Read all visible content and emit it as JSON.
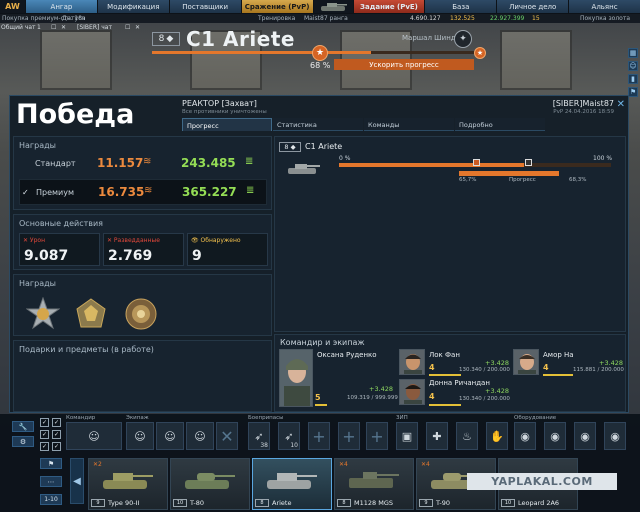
{
  "nav": {
    "logo": "AW",
    "tabs": [
      {
        "label": "Ангар",
        "style": "active"
      },
      {
        "label": "Модификация",
        "style": ""
      },
      {
        "label": "Поставщики",
        "style": ""
      },
      {
        "label": "Сражение (PvP)",
        "style": "pvp"
      },
      {
        "label": "",
        "style": "tankslot"
      },
      {
        "label": "Задание (PvE)",
        "style": "pve"
      },
      {
        "label": "База",
        "style": ""
      },
      {
        "label": "Личное дело",
        "style": ""
      },
      {
        "label": "Альянс",
        "style": ""
      }
    ]
  },
  "subnav": {
    "premium_link": "Покупка премиум-статуса",
    "premium_days": "Дн. 18ч",
    "mode": "Тренировка",
    "player_small": "Maist87 ранга",
    "silver": "4.690.127",
    "gold": "132.525",
    "xp": "22.927.399",
    "xp2": "15",
    "buy_gold": "Покупка золота"
  },
  "chats": {
    "general": "Общий чат",
    "general_count": "1",
    "clan": "[SIBER] чат"
  },
  "header": {
    "tier": "8",
    "tank_name": "C1 Ariete",
    "rank_name": "Маршал Шиндаев",
    "progress_pct": "68 %",
    "progress_value": 0.68,
    "speed_up": "Ускорить прогресс"
  },
  "result": {
    "title": "Победа",
    "map": "РЕАКТОР [Захват]",
    "mode": "Все противники уничтожены",
    "player": "[SIBER]Maist87",
    "date": "PvP 24.04.2016 18:59",
    "tabs": [
      "Прогресс",
      "Статистика",
      "Команды",
      "Подробно"
    ],
    "rewards": {
      "title": "Награды",
      "standard_label": "Стандарт",
      "standard_silver": "11.157",
      "standard_xp": "243.485",
      "premium_label": "Премиум",
      "premium_check": "✓",
      "premium_silver": "16.735",
      "premium_xp": "365.227"
    },
    "actions": {
      "title": "Основные действия",
      "damage_label": "✕ Урон",
      "damage_value": "9.087",
      "spotted_label": "✕ Разведданные",
      "spotted_value": "2.769",
      "detected_label": "👁 Обнаружено",
      "detected_value": "9"
    },
    "medals_title": "Награды",
    "gifts_title": "Подарки и предметы (в работе)",
    "tank": {
      "tier": "8",
      "name": "C1 Ariete",
      "pct_left": "0 %",
      "pct_right": "100 %",
      "sub_left": "65,7%",
      "sub_mid": "Прогресс",
      "sub_right": "68,3%"
    },
    "crew": {
      "title": "Командир и экипаж",
      "members": [
        {
          "name": "Оксана Руденко",
          "level": "5",
          "plus": "+3.428",
          "exp": "109.319 / 999.999",
          "fill": 0.11
        },
        {
          "name": "Лок Фан",
          "level": "4",
          "plus": "+3.428",
          "exp": "130.340 / 200.000",
          "fill": 0.65
        },
        {
          "name": "Амор На",
          "level": "4",
          "plus": "+3.428",
          "exp": "115.881 / 200.000",
          "fill": 0.58
        },
        {
          "name": "Донна Ричандан",
          "level": "4",
          "plus": "+3.428",
          "exp": "130.340 / 200.000",
          "fill": 0.65
        }
      ]
    }
  },
  "dock": {
    "commander_label": "Командир",
    "crew_label": "Экипаж",
    "ammo_label": "Боеприпасы",
    "ammo_counts": [
      "38",
      "10"
    ],
    "zip_label": "ЗИП",
    "equipment_label": "Оборудование",
    "page_label": "1-10",
    "tanks": [
      {
        "tier": "9",
        "name": "Type 90-II",
        "badge": "✕2"
      },
      {
        "tier": "10",
        "name": "T-80",
        "badge": ""
      },
      {
        "tier": "8",
        "name": "Ariete",
        "badge": ""
      },
      {
        "tier": "8",
        "name": "M1128 MGS",
        "badge": "✕4"
      },
      {
        "tier": "9",
        "name": "T-90",
        "badge": "✕4"
      },
      {
        "tier": "10",
        "name": "Leopard 2A6",
        "badge": ""
      }
    ]
  },
  "watermark": "YAPLAKAL.COM"
}
